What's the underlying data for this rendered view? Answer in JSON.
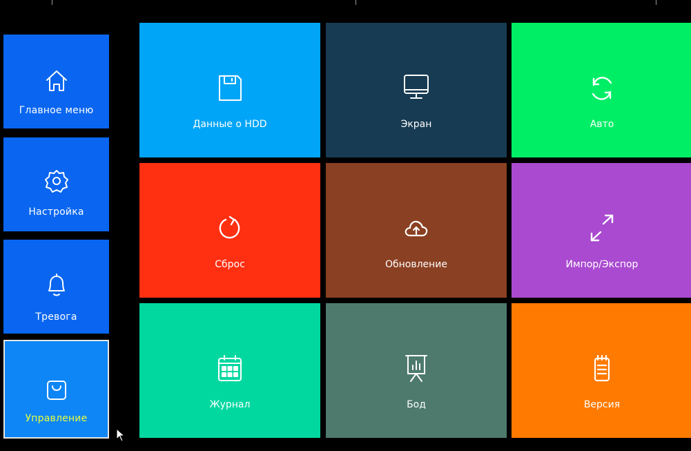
{
  "sidebar": {
    "items": [
      {
        "label": "Главное меню",
        "icon": "home-icon"
      },
      {
        "label": "Настройка",
        "icon": "gear-icon"
      },
      {
        "label": "Тревога",
        "icon": "bell-icon"
      },
      {
        "label": "Управление",
        "icon": "shopping-bag-icon",
        "active": true
      }
    ]
  },
  "tiles": [
    {
      "label": "Данные о HDD",
      "icon": "floppy-disk-icon",
      "color": "#00a5f7"
    },
    {
      "label": "Экран",
      "icon": "monitor-icon",
      "color": "#173b52"
    },
    {
      "label": "Авто",
      "icon": "refresh-icon",
      "color": "#00ee66"
    },
    {
      "label": "Сброс",
      "icon": "reset-icon",
      "color": "#ff2f12"
    },
    {
      "label": "Обновление",
      "icon": "cloud-upload-icon",
      "color": "#8a4022"
    },
    {
      "label": "Импор/Экспор",
      "icon": "expand-arrows-icon",
      "color": "#a94ad0"
    },
    {
      "label": "Журнал",
      "icon": "calendar-icon",
      "color": "#00d8a0"
    },
    {
      "label": "Бод",
      "icon": "presentation-board-icon",
      "color": "#4e7a6e"
    },
    {
      "label": "Версия",
      "icon": "clipboard-icon",
      "color": "#ff7a00"
    }
  ],
  "colors": {
    "sidebar_bg": "#0a66f0",
    "sidebar_active_bg": "#0f86f5",
    "active_label": "#e8ff3a",
    "background": "#000000"
  }
}
